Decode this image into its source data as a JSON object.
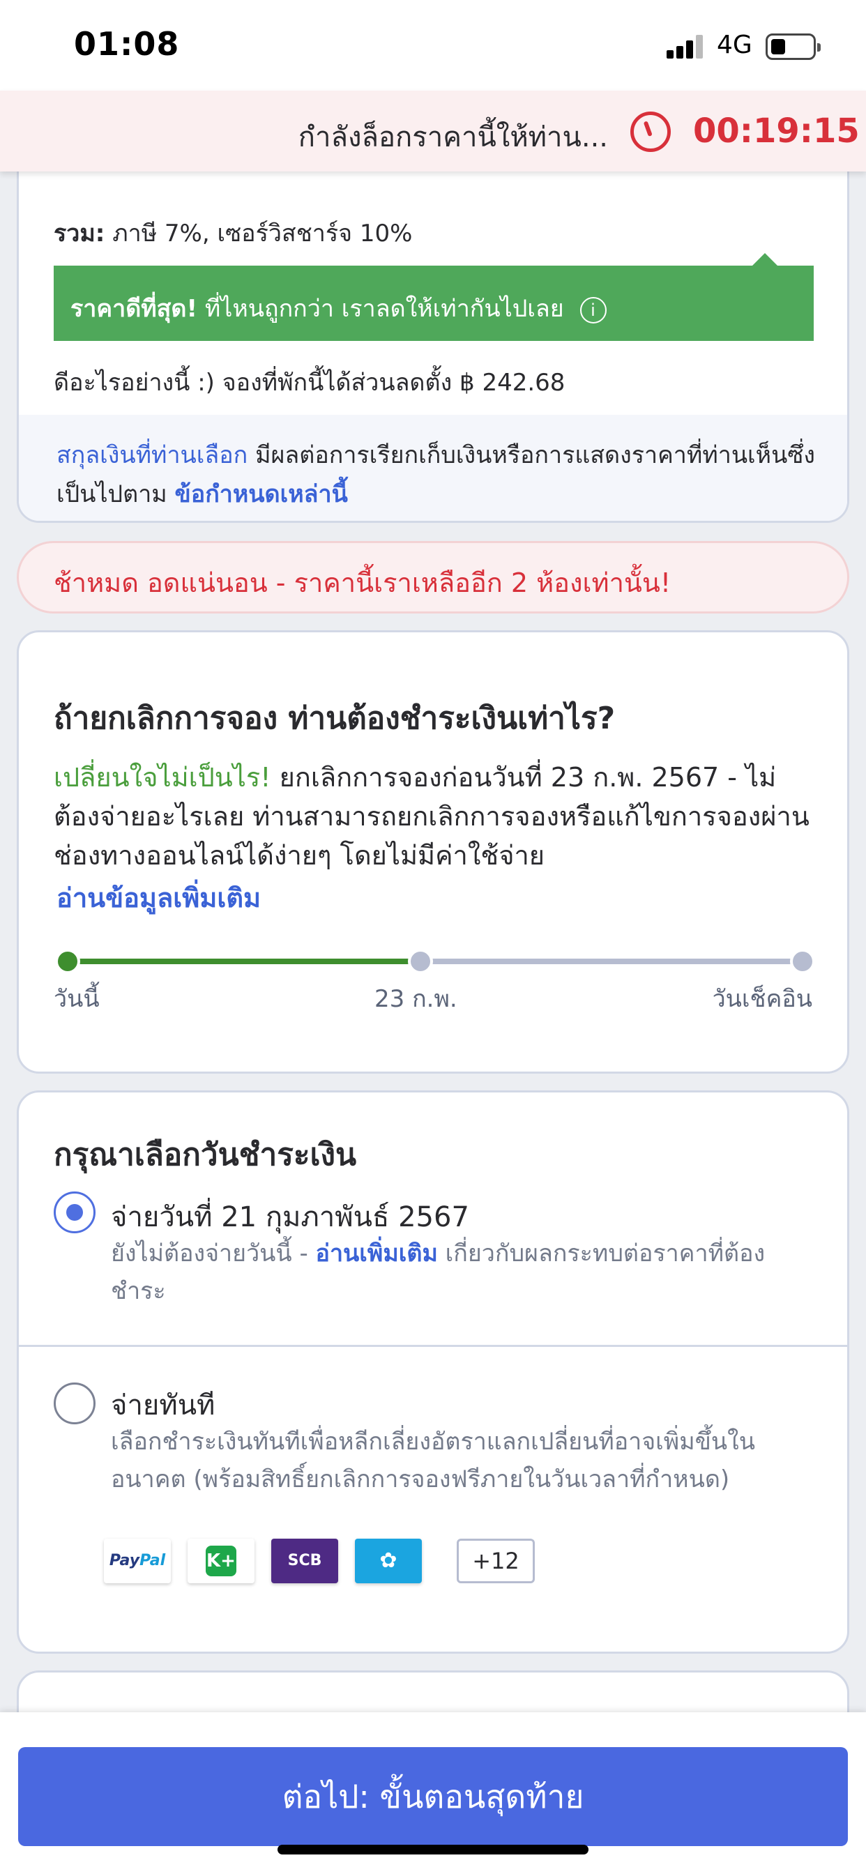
{
  "status_bar": {
    "time": "01:08",
    "network": "4G"
  },
  "lock_banner": {
    "text": "กำลังล็อกราคานี้ให้ท่าน...",
    "countdown": "00:19:15",
    "accent_color": "#d8303a",
    "icon": "clock-icon"
  },
  "price_summary": {
    "tax_label": "รวม:",
    "tax_text": "ภาษี 7%, เซอร์วิสชาร์จ 10%",
    "best_price_label": "ราคาดีที่สุด!",
    "best_price_text": "ที่ไหนถูกกว่า เราลดให้เท่ากันไปเลย",
    "best_price_info_icon": "info-icon",
    "discount_text": "ดีอะไรอย่างนี้ :) จองที่พักนี้ได้ส่วนลดตั้ง ฿ 242.68",
    "currency_link": "สกุลเงินที่ท่านเลือก",
    "currency_text": "มีผลต่อการเรียกเก็บเงินหรือการแสดงราคาที่ท่านเห็นซึ่งเป็นไปตาม",
    "terms_link": "ข้อกำหนดเหล่านี้"
  },
  "warning": {
    "text": "ช้าหมด อดแน่นอน - ราคานี้เราเหลืออีก 2 ห้องเท่านั้น!"
  },
  "cancellation": {
    "title": "ถ้ายกเลิกการจอง ท่านต้องชำระเงินเท่าไร?",
    "highlight": "เปลี่ยนใจไม่เป็นไร!",
    "body": "ยกเลิกการจองก่อนวันที่ 23 ก.พ. 2567 - ไม่ต้องจ่ายอะไรเลย ท่านสามารถยกเลิกการจองหรือแก้ไขการจองผ่านช่องทางออนไลน์ได้ง่ายๆ โดยไม่มีค่าใช้จ่าย",
    "read_more": "อ่านข้อมูลเพิ่มเติม",
    "timeline": {
      "start": "วันนี้",
      "mid": "23 ก.พ.",
      "end": "วันเช็คอิน",
      "progress_fraction": 0.48
    }
  },
  "payment_date": {
    "title": "กรุณาเลือกวันชำระเงิน",
    "option1": {
      "title": "จ่ายวันที่ 21 กุมภาพันธ์ 2567",
      "desc_prefix": "ยังไม่ต้องจ่ายวันนี้ -",
      "desc_link": "อ่านเพิ่มเติม",
      "desc_suffix": "เกี่ยวกับผลกระทบต่อราคาที่ต้องชำระ",
      "selected": true
    },
    "option2": {
      "title": "จ่ายทันที",
      "desc": "เลือกชำระเงินทันทีเพื่อหลีกเลี่ยงอัตราแลกเปลี่ยนที่อาจเพิ่มขึ้นในอนาคต (พร้อมสิทธิ์ยกเลิกการจองฟรีภายในวันเวลาที่กำหนด)",
      "selected": false
    },
    "payment_methods": {
      "paypal_a": "Pay",
      "paypal_b": "Pal",
      "kplus": "K+",
      "scb": "SCB",
      "kbank": "✿",
      "more": "+12"
    }
  },
  "footer": {
    "next_button": "ต่อไป: ขั้นตอนสุดท้าย",
    "button_color": "#4a68e0"
  }
}
